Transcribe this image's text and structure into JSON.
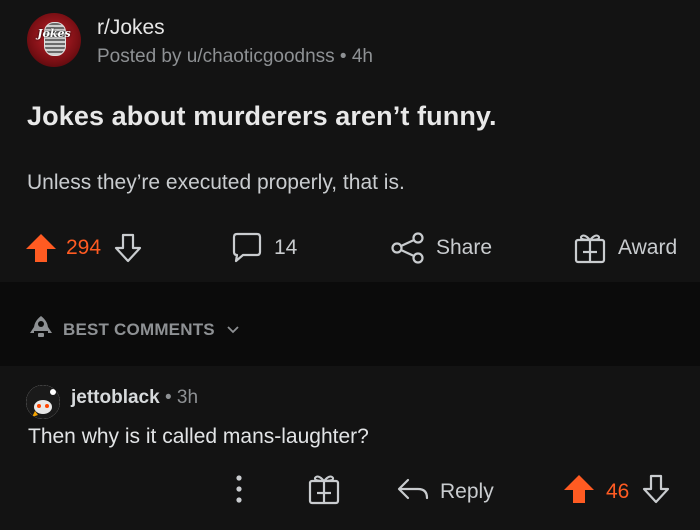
{
  "post": {
    "subreddit": "r/Jokes",
    "avatar_logo_text": "Jokes",
    "meta": "Posted by u/chaoticgoodnss • 4h",
    "title": "Jokes about murderers aren’t funny.",
    "body": "Unless they’re executed properly, that is.",
    "score": "294",
    "comments_count": "14",
    "share_label": "Share",
    "award_label": "Award"
  },
  "sort": {
    "label": "BEST COMMENTS"
  },
  "comment": {
    "username": "jettoblack",
    "time": " • 3h",
    "text": "Then why is it called mans-laughter?",
    "reply_label": "Reply",
    "score": "46"
  },
  "colors": {
    "background": "#0f0f0f",
    "card": "#131313",
    "upvote": "#ff5b22",
    "muted": "#8e9194",
    "text": "#d7dadc"
  }
}
